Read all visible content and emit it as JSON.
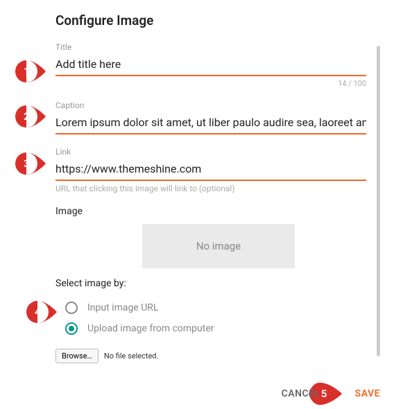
{
  "dialog": {
    "heading": "Configure Image",
    "title_field": {
      "label": "Title",
      "value": "Add title here",
      "counter": "14 / 100"
    },
    "caption_field": {
      "label": "Caption",
      "value": "Lorem ipsum dolor sit amet, ut liber paulo audire sea, laoreet an"
    },
    "link_field": {
      "label": "Link",
      "value": "https://www.themeshine.com",
      "hint": "URL that clicking this image will link to (optional)"
    },
    "image_section": {
      "label": "Image",
      "placeholder": "No image",
      "select_by_label": "Select image by:",
      "options": {
        "url": {
          "label": "Input image URL",
          "selected": false
        },
        "upload": {
          "label": "Upload image from computer",
          "selected": true
        }
      },
      "browse_button": "Browse…",
      "file_status": "No file selected."
    },
    "actions": {
      "cancel": "CANCEL",
      "save": "SAVE"
    }
  },
  "callouts": [
    "1",
    "2",
    "3",
    "4",
    "5"
  ]
}
